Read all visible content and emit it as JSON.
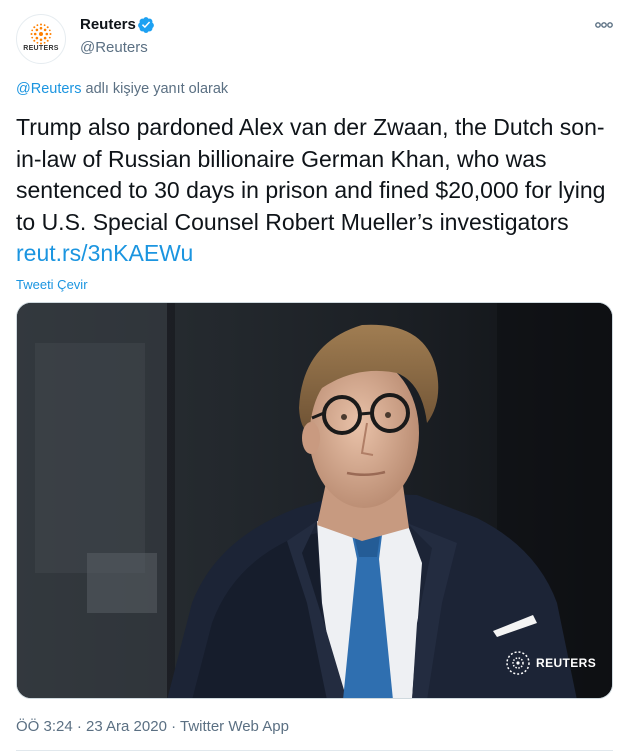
{
  "author": {
    "name": "Reuters",
    "handle": "@Reuters",
    "avatar_wordmark": "REUTERS",
    "verified_icon": "verified-badge-icon",
    "brand_color": "#ff8000",
    "verified_color": "#1da1f2"
  },
  "reply_context": {
    "mention": "@Reuters",
    "suffix": " adlı kişiye yanıt olarak"
  },
  "tweet": {
    "text": "Trump also pardoned Alex van der Zwaan, the Dutch son-in-law of Russian billionaire German Khan, who was sentenced to 30 days in prison and fined $20,000 for lying to U.S. Special Counsel Robert Mueller’s investigators ",
    "link": "reut.rs/3nKAEWu",
    "translate_label": "Tweeti Çevir",
    "link_color": "#1b95e0"
  },
  "media": {
    "watermark": "REUTERS",
    "watermark_icon": "reuters-logo-icon"
  },
  "meta": {
    "timestamp": "ÖÖ 3:24 · 23 Ara 2020 · Twitter Web App"
  },
  "icons": {
    "more": "more-options-icon"
  }
}
